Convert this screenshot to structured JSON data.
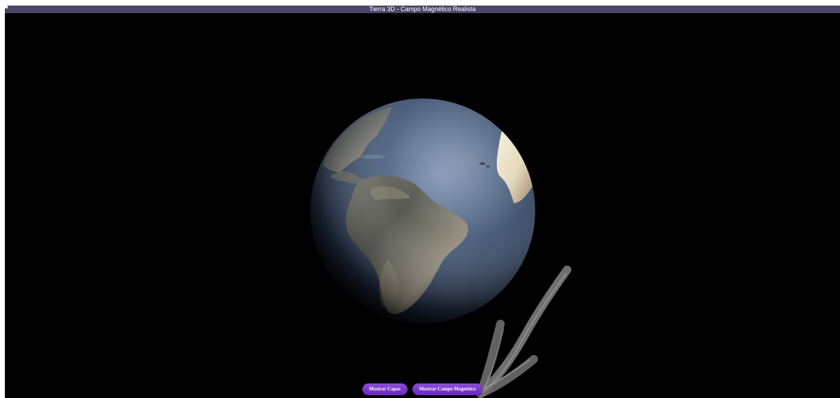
{
  "window": {
    "title": "Tierra 3D - Campo Magnético Realista"
  },
  "scene": {
    "globe": {
      "label": "",
      "icon": "earth-globe"
    },
    "annotation": {
      "icon": "hand-drawn-arrow"
    }
  },
  "controls": {
    "show_layers_label": "Mostrar Capas",
    "show_magnetic_field_label": "Mostrar Campo Magnético"
  },
  "colors": {
    "title_bar": "#4c4668",
    "canvas": "#000000",
    "button_purple": "#7a39cf",
    "ocean_blue": "#4d617e",
    "arrow_gray": "#7b7b7b"
  }
}
